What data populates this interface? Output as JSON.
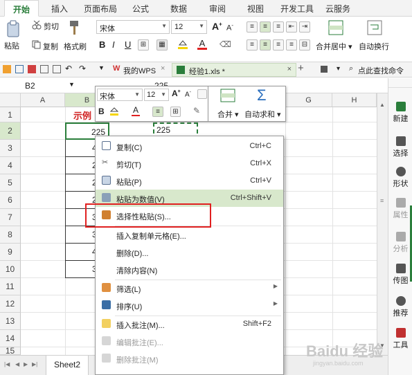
{
  "ribbon_tabs": [
    "开始",
    "插入",
    "页面布局",
    "公式",
    "数据",
    "审阅",
    "视图",
    "开发工具",
    "云服务"
  ],
  "ribbon": {
    "paste": "粘贴",
    "cut": "剪切",
    "copy": "复制",
    "format_painter": "格式刷",
    "font_name": "宋体",
    "font_size": "12",
    "bold": "B",
    "italic": "I",
    "underline": "U",
    "merge_center": "合并居中",
    "wrap_text": "自动换行"
  },
  "quick_access": {
    "my_wps": "我的WPS",
    "doc_tab": "经验1.xls *",
    "search_placeholder": "点此查找命令"
  },
  "formula_bar": {
    "cell_ref": "B2",
    "value": "225"
  },
  "columns": [
    "A",
    "B",
    "G",
    "H"
  ],
  "rows": [
    "1",
    "2",
    "3",
    "4",
    "5",
    "6",
    "7",
    "8",
    "9",
    "10",
    "11",
    "12",
    "13",
    "14",
    "15"
  ],
  "column_b": {
    "header": "示例",
    "values": [
      "225",
      "454",
      "205",
      "293",
      "203",
      "346",
      "384",
      "426",
      "359"
    ]
  },
  "clipboard_cell_value": "225",
  "mini_toolbar": {
    "font_name": "宋体",
    "font_size": "12",
    "bold": "B",
    "merge": "合并",
    "autosum": "自动求和"
  },
  "context_menu": [
    {
      "label": "复制(C)",
      "shortcut": "Ctrl+C",
      "icon": "copy-icon"
    },
    {
      "label": "剪切(T)",
      "shortcut": "Ctrl+X",
      "icon": "scissors-icon"
    },
    {
      "label": "粘贴(P)",
      "shortcut": "Ctrl+V",
      "icon": "paste-icon"
    },
    {
      "label": "粘贴为数值(V)",
      "shortcut": "Ctrl+Shift+V",
      "icon": "paste-values-icon"
    },
    {
      "label": "选择性粘贴(S)...",
      "shortcut": "",
      "icon": "paste-special-icon"
    },
    {
      "label": "插入复制单元格(E)...",
      "shortcut": "",
      "icon": ""
    },
    {
      "label": "删除(D)...",
      "shortcut": "",
      "icon": ""
    },
    {
      "label": "清除内容(N)",
      "shortcut": "",
      "icon": ""
    },
    {
      "label": "筛选(L)",
      "shortcut": "",
      "icon": "filter-icon"
    },
    {
      "label": "排序(U)",
      "shortcut": "",
      "icon": "sort-icon"
    },
    {
      "label": "插入批注(M)...",
      "shortcut": "Shift+F2",
      "icon": "insert-comment-icon"
    },
    {
      "label": "编辑批注(E)...",
      "shortcut": "",
      "icon": "edit-comment-icon"
    },
    {
      "label": "删除批注(M)",
      "shortcut": "",
      "icon": "delete-comment-icon"
    }
  ],
  "right_panel": [
    "新建",
    "选择",
    "形状",
    "属性",
    "分析",
    "传图",
    "推荐",
    "工具"
  ],
  "sheet_tab": "Sheet2",
  "colors": {
    "accent_green": "#2a7e3b",
    "highlight_row": "#d8e8cc",
    "annotation_red": "#e02020",
    "title_red": "#d02020"
  }
}
